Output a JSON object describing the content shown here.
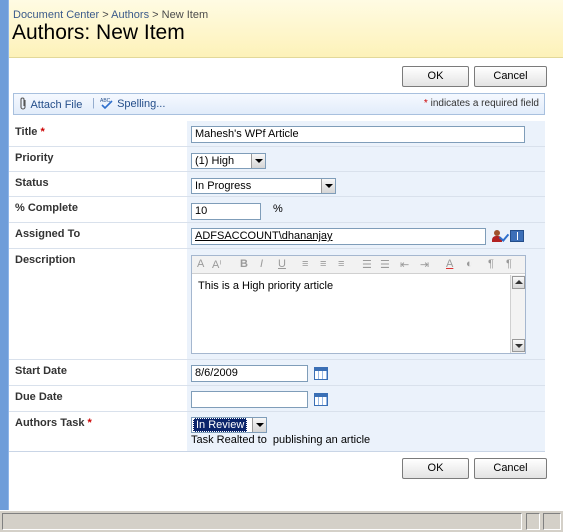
{
  "breadcrumb": {
    "items": [
      "Document Center",
      "Authors",
      "New Item"
    ],
    "separator": ">"
  },
  "page_title": "Authors: New Item",
  "buttons": {
    "ok": "OK",
    "cancel": "Cancel"
  },
  "toolbar": {
    "attach_file": "Attach File",
    "spelling": "Spelling...",
    "required_marker": "*",
    "required_note": "indicates a required field"
  },
  "form": {
    "title": {
      "label": "Title",
      "required": "*",
      "value": "Mahesh's WPf Article"
    },
    "priority": {
      "label": "Priority",
      "value": "(1) High"
    },
    "status": {
      "label": "Status",
      "value": "In Progress"
    },
    "percent_complete": {
      "label": "% Complete",
      "value": "10",
      "suffix": "%"
    },
    "assigned_to": {
      "label": "Assigned To",
      "value": "ADFSACCOUNT\\dhananjay"
    },
    "description": {
      "label": "Description",
      "value": "This is a High priority article",
      "toolbar_glyphs": [
        "A",
        "Aⁱ",
        "B",
        "I",
        "U",
        "≡",
        "≡",
        "≡",
        "☰",
        "☰",
        "⇤",
        "⇥",
        "A",
        "◐",
        "¶",
        "¶"
      ]
    },
    "start_date": {
      "label": "Start Date",
      "value": "8/6/2009"
    },
    "due_date": {
      "label": "Due Date",
      "value": ""
    },
    "authors_task": {
      "label": "Authors Task",
      "required": "*",
      "value": "In Review",
      "note": "Task Realted to  publishing an article"
    }
  },
  "colors": {
    "accent_bar": "#6f9dd9",
    "title_bg": "#fdf2b9",
    "field_bg": "#ebf2fb",
    "link": "#3b5a8a",
    "required": "#cc0000",
    "selected_option_bg": "#0a246a"
  },
  "icons": [
    "paperclip-icon",
    "spelling-icon",
    "check-names-icon",
    "address-book-icon",
    "calendar-icon"
  ]
}
